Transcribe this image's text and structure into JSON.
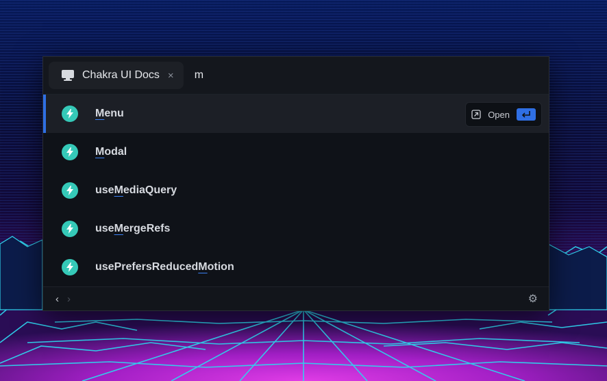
{
  "header": {
    "tab_label": "Chakra UI Docs",
    "close_glyph": "×",
    "query": "m"
  },
  "results": [
    {
      "pre": "",
      "hl": "M",
      "post": "enu",
      "selected": true
    },
    {
      "pre": "",
      "hl": "M",
      "post": "odal",
      "selected": false
    },
    {
      "pre": "use",
      "hl": "M",
      "post": "ediaQuery",
      "selected": false
    },
    {
      "pre": "use",
      "hl": "M",
      "post": "ergeRefs",
      "selected": false
    },
    {
      "pre": "usePrefersReduced",
      "hl": "M",
      "post": "otion",
      "selected": false
    }
  ],
  "action": {
    "label": "Open",
    "icons": [
      "external-link-icon",
      "enter-key-icon"
    ]
  },
  "footer": {
    "back_glyph": "‹",
    "forward_glyph": "›",
    "settings_glyph": "⚙"
  },
  "colors": {
    "accent": "#2f6fe4",
    "icon_bg": "#35c9b8",
    "neon_grid": "#29d8f0",
    "magenta": "#d12bd9"
  }
}
